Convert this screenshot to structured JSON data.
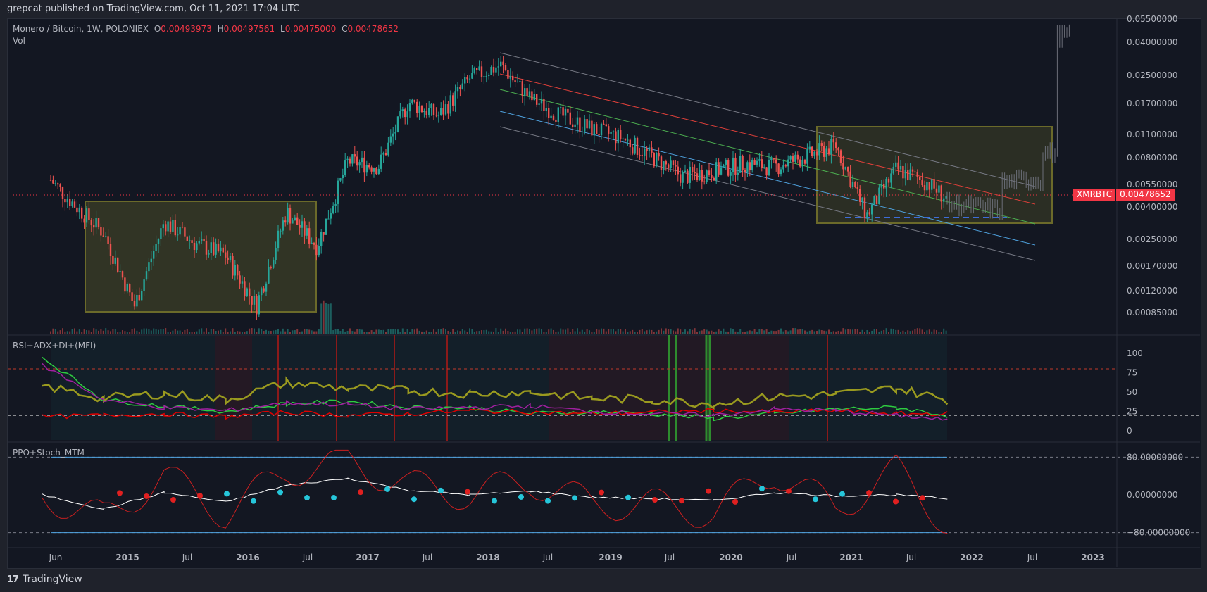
{
  "header": {
    "publisher": "grepcat published on TradingView.com, Oct 11, 2021 17:04 UTC"
  },
  "symbol": {
    "name": "Monero / Bitcoin, 1W, POLONIEX",
    "o_label": "O",
    "o": "0.00493973",
    "h_label": "H",
    "h": "0.00497561",
    "l_label": "L",
    "l": "0.00475000",
    "c_label": "C",
    "c": "0.00478652",
    "vol_label": "Vol",
    "ticker": "XMRBTC",
    "last_price": "0.00478652"
  },
  "colors": {
    "up": "#26a69a",
    "down": "#ef5350",
    "bg": "#131722",
    "box": "#6b6a2a"
  },
  "chart_data": [
    {
      "type": "candlestick",
      "title": "Monero / Bitcoin, 1W, POLONIEX",
      "scale": "log",
      "price_ticks": [
        "0.05500000",
        "0.04000000",
        "0.02500000",
        "0.01700000",
        "0.01100000",
        "0.00800000",
        "0.00550000",
        "0.00400000",
        "0.00250000",
        "0.00170000",
        "0.00120000",
        "0.00085000"
      ],
      "time_ticks": [
        "Jun",
        "2015",
        "Jul",
        "2016",
        "Jul",
        "2017",
        "Jul",
        "2018",
        "Jul",
        "2019",
        "Jul",
        "2020",
        "Jul",
        "2021",
        "Jul",
        "2022",
        "Jul",
        "2023"
      ],
      "x": [
        "2014-05",
        "2014-08",
        "2014-11",
        "2015-02",
        "2015-05",
        "2015-08",
        "2015-11",
        "2016-02",
        "2016-05",
        "2016-08",
        "2016-11",
        "2017-02",
        "2017-05",
        "2017-08",
        "2017-11",
        "2018-02",
        "2018-05",
        "2018-08",
        "2018-11",
        "2019-02",
        "2019-05",
        "2019-08",
        "2019-11",
        "2020-02",
        "2020-05",
        "2020-08",
        "2020-11",
        "2021-02",
        "2021-05",
        "2021-08",
        "2021-10"
      ],
      "close": [
        0.007,
        0.0045,
        0.003,
        0.0011,
        0.0035,
        0.0026,
        0.0022,
        0.0011,
        0.004,
        0.0025,
        0.008,
        0.0075,
        0.018,
        0.015,
        0.025,
        0.03,
        0.019,
        0.015,
        0.0125,
        0.011,
        0.0085,
        0.0065,
        0.007,
        0.0078,
        0.0074,
        0.0085,
        0.01,
        0.0038,
        0.0072,
        0.006,
        0.00478652
      ]
    },
    {
      "type": "line",
      "title": "RSI+ADX+DI+(MFI)",
      "y_ticks": [
        "100",
        "75",
        "50",
        "25",
        "0"
      ],
      "ylim": [
        0,
        100
      ],
      "x": [
        "2014-05",
        "2014-11",
        "2015-05",
        "2015-11",
        "2016-05",
        "2016-11",
        "2017-05",
        "2017-11",
        "2018-05",
        "2018-11",
        "2019-05",
        "2019-11",
        "2020-05",
        "2020-11",
        "2021-05",
        "2021-10"
      ],
      "series": [
        {
          "color": "#9a9a1f",
          "values": [
            58,
            42,
            48,
            40,
            62,
            55,
            52,
            48,
            50,
            42,
            40,
            35,
            44,
            47,
            55,
            40
          ]
        },
        {
          "color": "#2ecc40",
          "values": [
            95,
            40,
            32,
            25,
            35,
            38,
            30,
            30,
            22,
            25,
            22,
            16,
            22,
            28,
            30,
            20
          ]
        },
        {
          "color": "#e00000",
          "values": [
            18,
            20,
            22,
            18,
            24,
            20,
            22,
            26,
            24,
            22,
            24,
            26,
            24,
            26,
            22,
            22
          ]
        },
        {
          "color": "#a020a0",
          "values": [
            85,
            40,
            30,
            26,
            36,
            34,
            28,
            30,
            32,
            25,
            22,
            20,
            28,
            26,
            20,
            14
          ]
        }
      ]
    },
    {
      "type": "line",
      "title": "PPO+Stoch_MTM",
      "y_ticks": [
        "80.00000000",
        "0.00000000",
        "−80.00000000"
      ],
      "ylim": [
        -100,
        100
      ],
      "x": [
        "2014-05",
        "2014-11",
        "2015-05",
        "2015-11",
        "2016-05",
        "2016-11",
        "2017-05",
        "2017-11",
        "2018-05",
        "2018-11",
        "2019-05",
        "2019-11",
        "2020-05",
        "2020-11",
        "2021-05",
        "2021-10"
      ],
      "series": [
        {
          "color": "#ffffff",
          "values": [
            0,
            -30,
            5,
            -15,
            20,
            35,
            10,
            0,
            8,
            -5,
            -8,
            -12,
            5,
            -2,
            0,
            -8
          ]
        },
        {
          "color": "#cc2020",
          "values": [
            0,
            -50,
            40,
            -40,
            50,
            70,
            20,
            0,
            30,
            -20,
            -20,
            -40,
            50,
            -30,
            50,
            -60
          ]
        }
      ]
    }
  ],
  "footer": {
    "brand": "TradingView"
  }
}
